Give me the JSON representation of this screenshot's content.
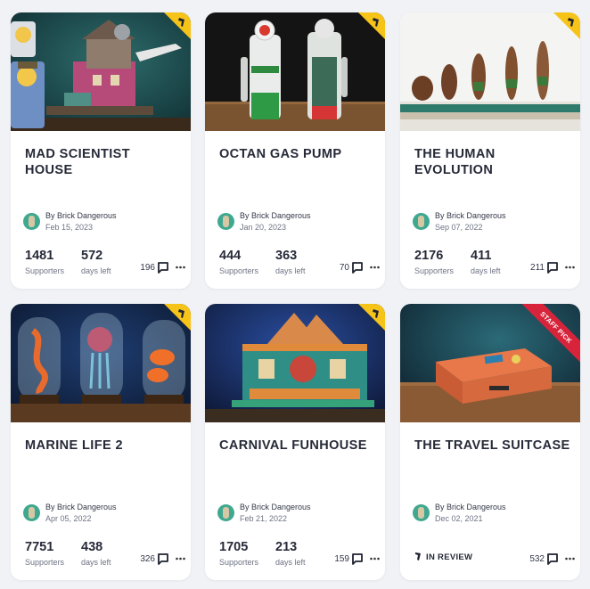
{
  "projects": [
    {
      "title": "MAD SCIENTIST HOUSE",
      "author": "By Brick Dangerous",
      "date": "Feb 15, 2023",
      "supporters": "1481",
      "supporters_label": "Supporters",
      "days_left": "572",
      "days_left_label": "days left",
      "comments": "196"
    },
    {
      "title": "OCTAN GAS PUMP",
      "author": "By Brick Dangerous",
      "date": "Jan 20, 2023",
      "supporters": "444",
      "supporters_label": "Supporters",
      "days_left": "363",
      "days_left_label": "days left",
      "comments": "70"
    },
    {
      "title": "THE HUMAN EVOLUTION",
      "author": "By Brick Dangerous",
      "date": "Sep 07, 2022",
      "supporters": "2176",
      "supporters_label": "Supporters",
      "days_left": "411",
      "days_left_label": "days left",
      "comments": "211"
    },
    {
      "title": "MARINE LIFE 2",
      "author": "By Brick Dangerous",
      "date": "Apr 05, 2022",
      "supporters": "7751",
      "supporters_label": "Supporters",
      "days_left": "438",
      "days_left_label": "days left",
      "comments": "326"
    },
    {
      "title": "CARNIVAL FUNHOUSE",
      "author": "By Brick Dangerous",
      "date": "Feb 21, 2022",
      "supporters": "1705",
      "supporters_label": "Supporters",
      "days_left": "213",
      "days_left_label": "days left",
      "comments": "159"
    },
    {
      "title": "THE TRAVEL SUITCASE",
      "author": "By Brick Dangerous",
      "date": "Dec 02, 2021",
      "status": "IN REVIEW",
      "staff_pick": "STAFF PICK",
      "comments": "532"
    }
  ],
  "icons": {
    "comment": "comment-icon",
    "more": "more-options-icon",
    "corner": "ideas-badge-icon",
    "review": "in-review-icon"
  },
  "colors": {
    "page_bg": "#f1f2f6",
    "card_bg": "#ffffff",
    "badge_yellow": "#f6c318",
    "staff_pick_red": "#d8243b",
    "avatar_green": "#3fa890"
  }
}
